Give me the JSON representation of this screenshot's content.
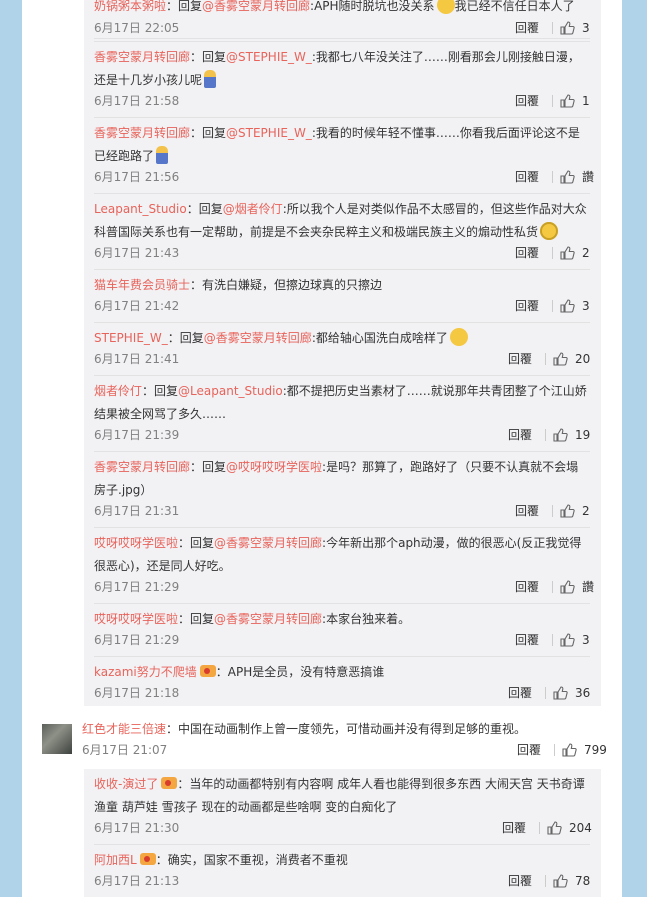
{
  "comments": [
    {
      "name": "奶锅粥本粥啦",
      "pre": "：回复",
      "mention": "@香雾空蒙月转回廊",
      "text": ":APH随时脱坑也没关系",
      "tail": "我已经不信任日本人了",
      "time": "6月17日 22:05",
      "reply": "回覆",
      "likes": "3"
    },
    {
      "name": "香雾空蒙月转回廊",
      "pre": "：回复",
      "mention": "@STEPHIE_W_",
      "text": ":我都七八年没关注了……刚看那会儿刚接触日漫，还是十几岁小孩儿呢",
      "tail": "",
      "time": "6月17日 21:58",
      "reply": "回覆",
      "likes": "1"
    },
    {
      "name": "香雾空蒙月转回廊",
      "pre": "：回复",
      "mention": "@STEPHIE_W_",
      "text": ":我看的时候年轻不懂事……你看我后面评论这不是已经跑路了",
      "tail": "",
      "time": "6月17日 21:56",
      "reply": "回覆",
      "likes": "讚"
    },
    {
      "name": "Leapant_Studio",
      "pre": "：回复",
      "mention": "@烟者伶仃",
      "text": ":所以我个人是对类似作品不太感冒的，但这些作品对大众科普国际关系也有一定帮助，前提是不会夹杂民粹主义和极端民族主义的煽动性私货",
      "tail": "",
      "time": "6月17日 21:43",
      "reply": "回覆",
      "likes": "2"
    },
    {
      "name": "猫车年费会员骑士",
      "pre": "",
      "mention": "",
      "text": "：有洗白嫌疑，但擦边球真的只擦边",
      "tail": "",
      "time": "6月17日 21:42",
      "reply": "回覆",
      "likes": "3"
    },
    {
      "name": "STEPHIE_W_",
      "pre": "：回复",
      "mention": "@香雾空蒙月转回廊",
      "text": ":都给轴心国洗白成啥样了",
      "tail": "",
      "time": "6月17日 21:41",
      "reply": "回覆",
      "likes": "20"
    },
    {
      "name": "烟者伶仃",
      "pre": "：回复",
      "mention": "@Leapant_Studio",
      "text": ":都不提把历史当素材了……就说那年共青团整了个江山娇结果被全网骂了多久……",
      "tail": "",
      "time": "6月17日 21:39",
      "reply": "回覆",
      "likes": "19"
    },
    {
      "name": "香雾空蒙月转回廊",
      "pre": "：回复",
      "mention": "@哎呀哎呀学医啦",
      "text": ":是吗？那算了，跑路好了（只要不认真就不会塌房子.jpg）",
      "tail": "",
      "time": "6月17日 21:31",
      "reply": "回覆",
      "likes": "2"
    },
    {
      "name": "哎呀哎呀学医啦",
      "pre": "：回复",
      "mention": "@香雾空蒙月转回廊",
      "text": ":今年新出那个aph动漫，做的很恶心(反正我觉得很恶心)，还是同人好吃。",
      "tail": "",
      "time": "6月17日 21:29",
      "reply": "回覆",
      "likes": "讚"
    },
    {
      "name": "哎呀哎呀学医啦",
      "pre": "：回复",
      "mention": "@香雾空蒙月转回廊",
      "text": ":本家台独来着。",
      "tail": "",
      "time": "6月17日 21:29",
      "reply": "回覆",
      "likes": "3"
    },
    {
      "name": "kazami努力不爬墙",
      "pre": "",
      "mention": "",
      "text": "：APH是全员，没有特意恶搞谁",
      "tail": "",
      "time": "6月17日 21:18",
      "reply": "回覆",
      "likes": "36"
    }
  ],
  "top_comment": {
    "name": "红色才能三倍速",
    "text": "：中国在动画制作上曾一度领先，可惜动画并没有得到足够的重视。",
    "time": "6月17日 21:07",
    "reply": "回覆",
    "likes": "799"
  },
  "sub_comments": [
    {
      "name": "收收-演过了",
      "text": "：当年的动画都特别有内容啊 成年人看也能得到很多东西 大闹天宫 天书奇谭 渔童 葫芦娃 雪孩子 现在的动画都是些啥啊 变的白痴化了",
      "time": "6月17日 21:30",
      "reply": "回覆",
      "likes": "204"
    },
    {
      "name": "阿加西L",
      "text": "：确实，国家不重视，消费者不重视",
      "time": "6月17日 21:13",
      "reply": "回覆",
      "likes": "78"
    }
  ]
}
